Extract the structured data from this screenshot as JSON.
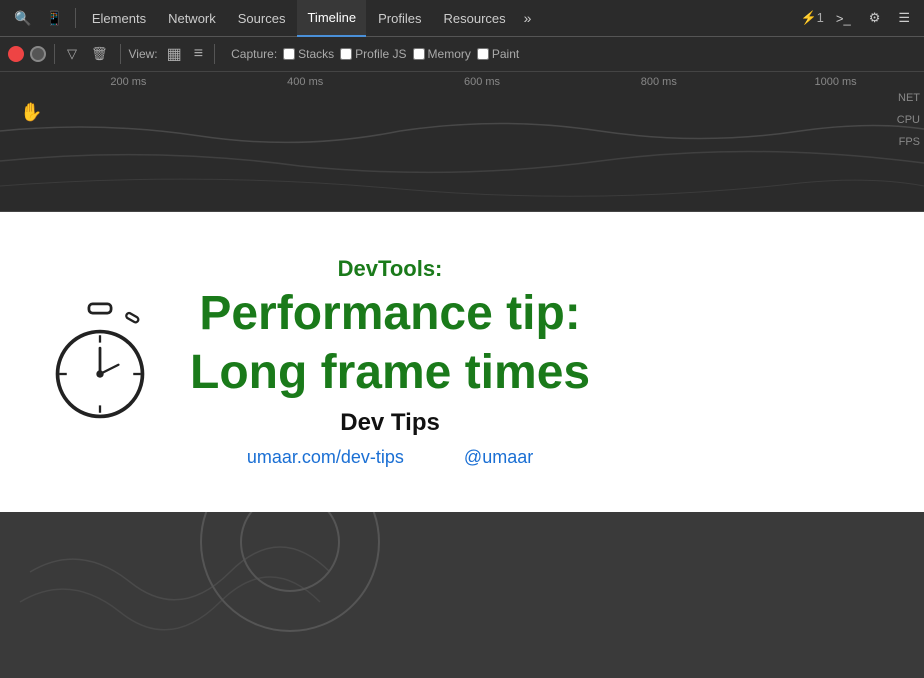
{
  "toolbar": {
    "tabs": [
      {
        "label": "Elements",
        "active": false
      },
      {
        "label": "Network",
        "active": false
      },
      {
        "label": "Sources",
        "active": false
      },
      {
        "label": "Timeline",
        "active": true
      },
      {
        "label": "Profiles",
        "active": false
      },
      {
        "label": "Resources",
        "active": false
      }
    ],
    "more_icon": "»",
    "device_icon": "📱",
    "search_icon": "🔍",
    "counter": "⚡1",
    "terminal_icon": ">_",
    "gear_icon": "⚙",
    "menu_icon": "☰"
  },
  "toolbar2": {
    "view_label": "View:",
    "capture_label": "Capture:",
    "checkboxes": [
      {
        "label": "Stacks",
        "checked": false
      },
      {
        "label": "Profile JS",
        "checked": false
      },
      {
        "label": "Memory",
        "checked": false
      },
      {
        "label": "Paint",
        "checked": false
      }
    ]
  },
  "ruler": {
    "ticks": [
      "200 ms",
      "400 ms",
      "600 ms",
      "800 ms",
      "1000 ms"
    ]
  },
  "right_labels": {
    "net": "NET",
    "cpu": "CPU",
    "fps": "FPS"
  },
  "card": {
    "devtools_label": "DevTools:",
    "title_line1": "Performance tip:",
    "title_line2": "Long frame times",
    "subtitle": "Dev Tips",
    "link1": "umaar.com/dev-tips",
    "link2": "@umaar"
  },
  "colors": {
    "green": "#1a7a1a",
    "blue": "#1a6fd4",
    "dark_bg": "#2b2b2b",
    "bottom_bg": "#3a3a3a"
  }
}
